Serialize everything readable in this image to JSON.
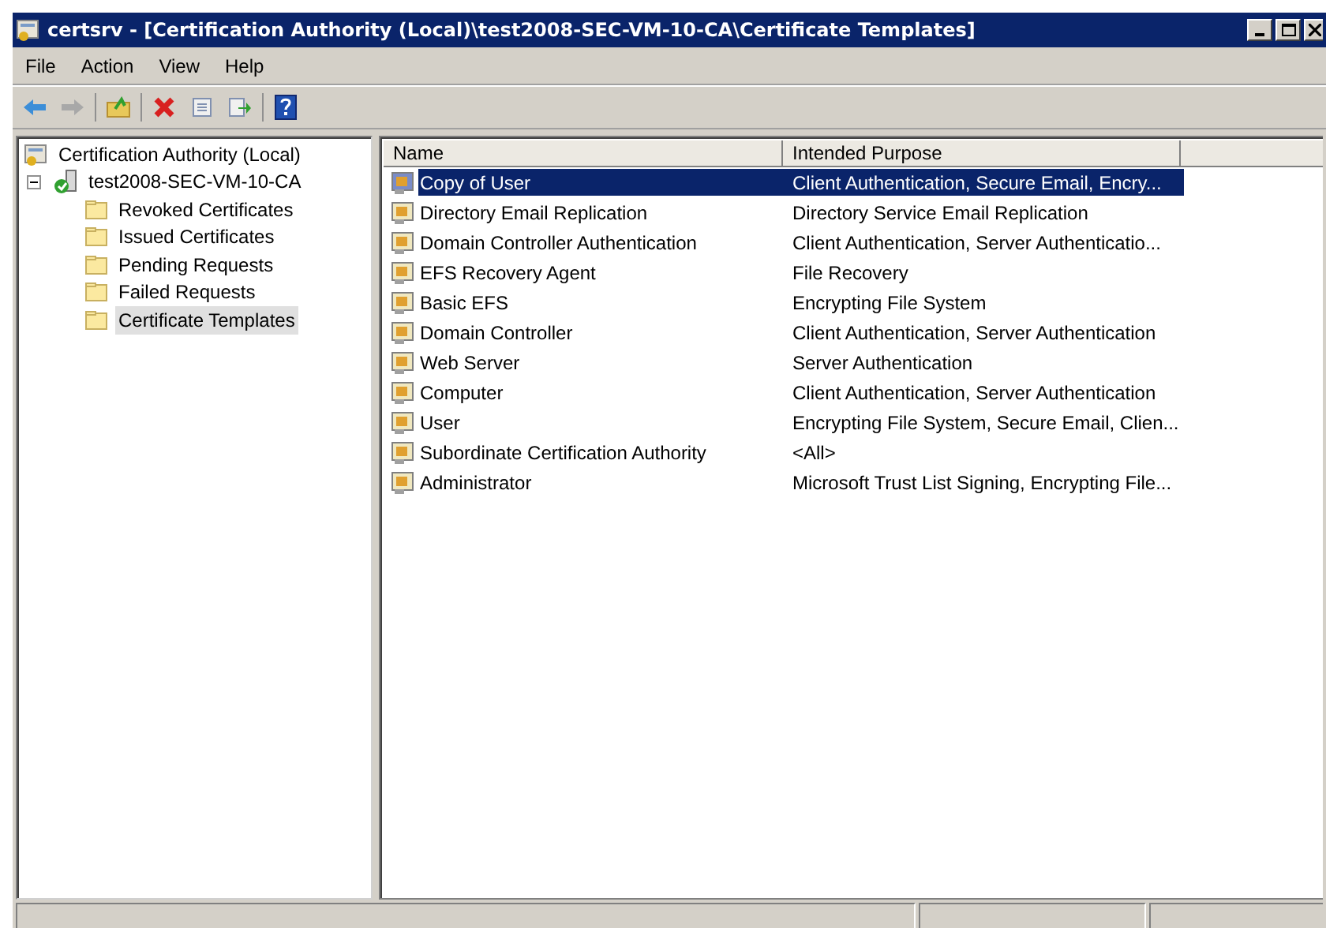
{
  "window": {
    "title": "certsrv - [Certification Authority (Local)\\test2008-SEC-VM-10-CA\\Certificate Templates]"
  },
  "menu": [
    "File",
    "Action",
    "View",
    "Help"
  ],
  "tree": [
    {
      "label": "Certification Authority (Local)",
      "kind": "root",
      "selected": false,
      "children": [
        {
          "label": "test2008-SEC-VM-10-CA",
          "kind": "ca",
          "selected": false,
          "expanded": true,
          "children": [
            {
              "label": "Revoked Certificates",
              "kind": "folder",
              "selected": false
            },
            {
              "label": "Issued Certificates",
              "kind": "folder",
              "selected": false
            },
            {
              "label": "Pending Requests",
              "kind": "folder",
              "selected": false
            },
            {
              "label": "Failed Requests",
              "kind": "folder",
              "selected": false
            },
            {
              "label": "Certificate Templates",
              "kind": "folder",
              "selected": true
            }
          ]
        }
      ]
    }
  ],
  "table": {
    "columns": [
      "Name",
      "Intended Purpose"
    ],
    "rows": [
      {
        "name": "Copy of User",
        "purpose": "Client Authentication, Secure Email, Encry...",
        "selected": true
      },
      {
        "name": "Directory Email Replication",
        "purpose": "Directory Service Email Replication",
        "selected": false
      },
      {
        "name": "Domain Controller Authentication",
        "purpose": "Client Authentication, Server Authenticatio...",
        "selected": false
      },
      {
        "name": "EFS Recovery Agent",
        "purpose": "File Recovery",
        "selected": false
      },
      {
        "name": "Basic EFS",
        "purpose": "Encrypting File System",
        "selected": false
      },
      {
        "name": "Domain Controller",
        "purpose": "Client Authentication, Server Authentication",
        "selected": false
      },
      {
        "name": "Web Server",
        "purpose": "Server Authentication",
        "selected": false
      },
      {
        "name": "Computer",
        "purpose": "Client Authentication, Server Authentication",
        "selected": false
      },
      {
        "name": "User",
        "purpose": "Encrypting File System, Secure Email, Clien...",
        "selected": false
      },
      {
        "name": "Subordinate Certification Authority",
        "purpose": "<All>",
        "selected": false
      },
      {
        "name": "Administrator",
        "purpose": "Microsoft Trust List Signing, Encrypting File...",
        "selected": false
      }
    ]
  }
}
